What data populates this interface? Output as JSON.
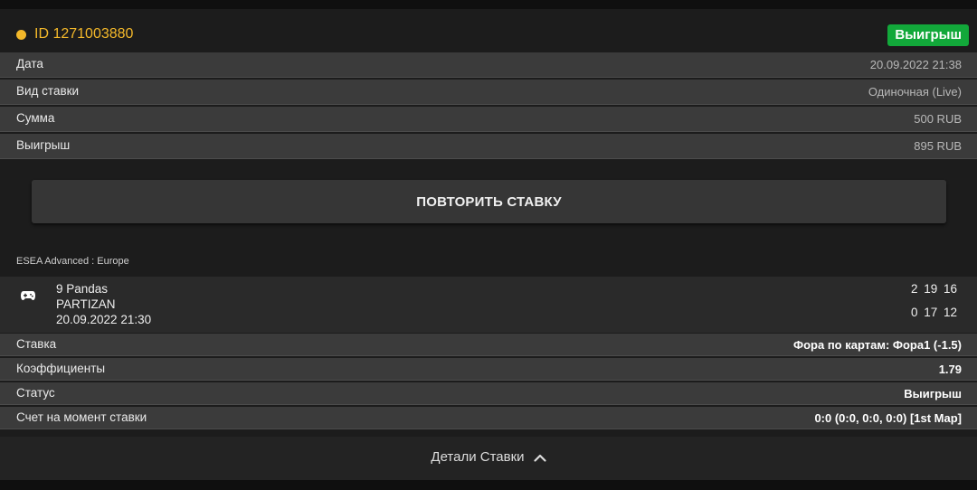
{
  "header": {
    "bet_id": "ID 1271003880",
    "status_badge": "Выигрыш",
    "status_color": "#12a83a",
    "accent_color": "#f3b82a"
  },
  "summary": [
    {
      "label": "Дата",
      "value": "20.09.2022 21:38"
    },
    {
      "label": "Вид ставки",
      "value": "Одиночная (Live)"
    },
    {
      "label": "Сумма",
      "value": "500 RUB"
    },
    {
      "label": "Выигрыш",
      "value": "895 RUB"
    }
  ],
  "repeat_button": "ПОВТОРИТЬ СТАВКУ",
  "event": {
    "league": "ESEA Advanced : Europe",
    "icon": "gamepad-icon",
    "team1": "9 Pandas",
    "team2": "PARTIZAN",
    "datetime": "20.09.2022 21:30",
    "score1": "2 19 16",
    "score2": "0 17 12"
  },
  "details": [
    {
      "label": "Ставка",
      "value": "Фора по картам: Фора1 (-1.5)"
    },
    {
      "label": "Коэффициенты",
      "value": "1.79"
    },
    {
      "label": "Статус",
      "value": "Выигрыш"
    },
    {
      "label": "Счет на момент ставки",
      "value": "0:0 (0:0, 0:0, 0:0) [1st Map]"
    }
  ],
  "footer": {
    "details_label": "Детали Ставки",
    "icon": "chevron-up-icon"
  }
}
